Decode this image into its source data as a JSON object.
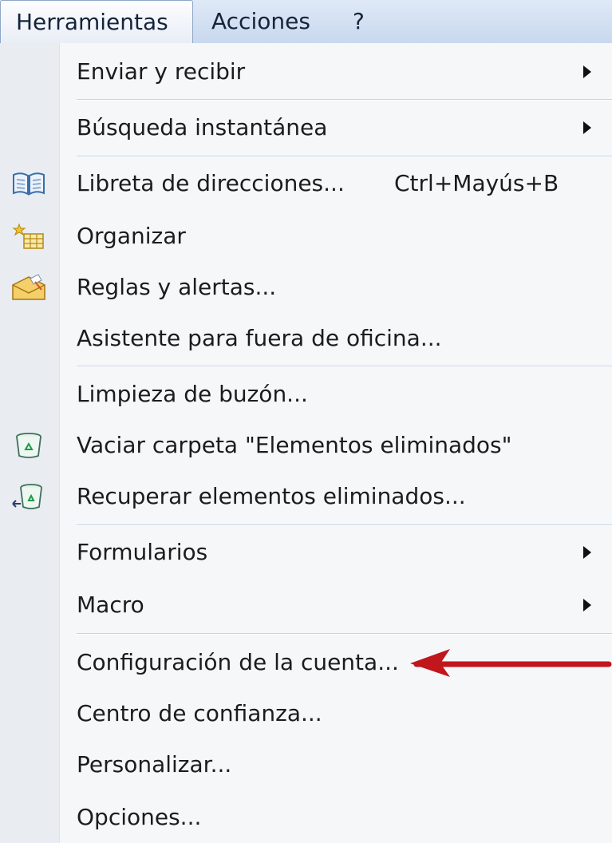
{
  "menubar": {
    "items": [
      {
        "label": "Herramientas"
      },
      {
        "label": "Acciones"
      },
      {
        "label": "?"
      }
    ]
  },
  "menu": {
    "items": [
      {
        "label": "Enviar y recibir",
        "submenu": true
      },
      {
        "label": "Búsqueda instantánea",
        "submenu": true
      },
      {
        "label": "Libreta de direcciones...",
        "shortcut": "Ctrl+Mayús+B",
        "icon": "address-book-icon"
      },
      {
        "label": "Organizar",
        "icon": "organize-icon"
      },
      {
        "label": "Reglas y alertas...",
        "icon": "rules-alerts-icon"
      },
      {
        "label": "Asistente para fuera de oficina..."
      },
      {
        "label": "Limpieza de buzón..."
      },
      {
        "label": "Vaciar carpeta \"Elementos eliminados\"",
        "icon": "recycle-bin-icon"
      },
      {
        "label": "Recuperar elementos eliminados...",
        "icon": "recover-bin-icon"
      },
      {
        "label": "Formularios",
        "submenu": true
      },
      {
        "label": "Macro",
        "submenu": true
      },
      {
        "label": "Configuración de la cuenta..."
      },
      {
        "label": "Centro de confianza..."
      },
      {
        "label": "Personalizar..."
      },
      {
        "label": "Opciones..."
      }
    ]
  },
  "annotation": {
    "color": "#c0161c",
    "icon": "red-pointer-arrow"
  }
}
